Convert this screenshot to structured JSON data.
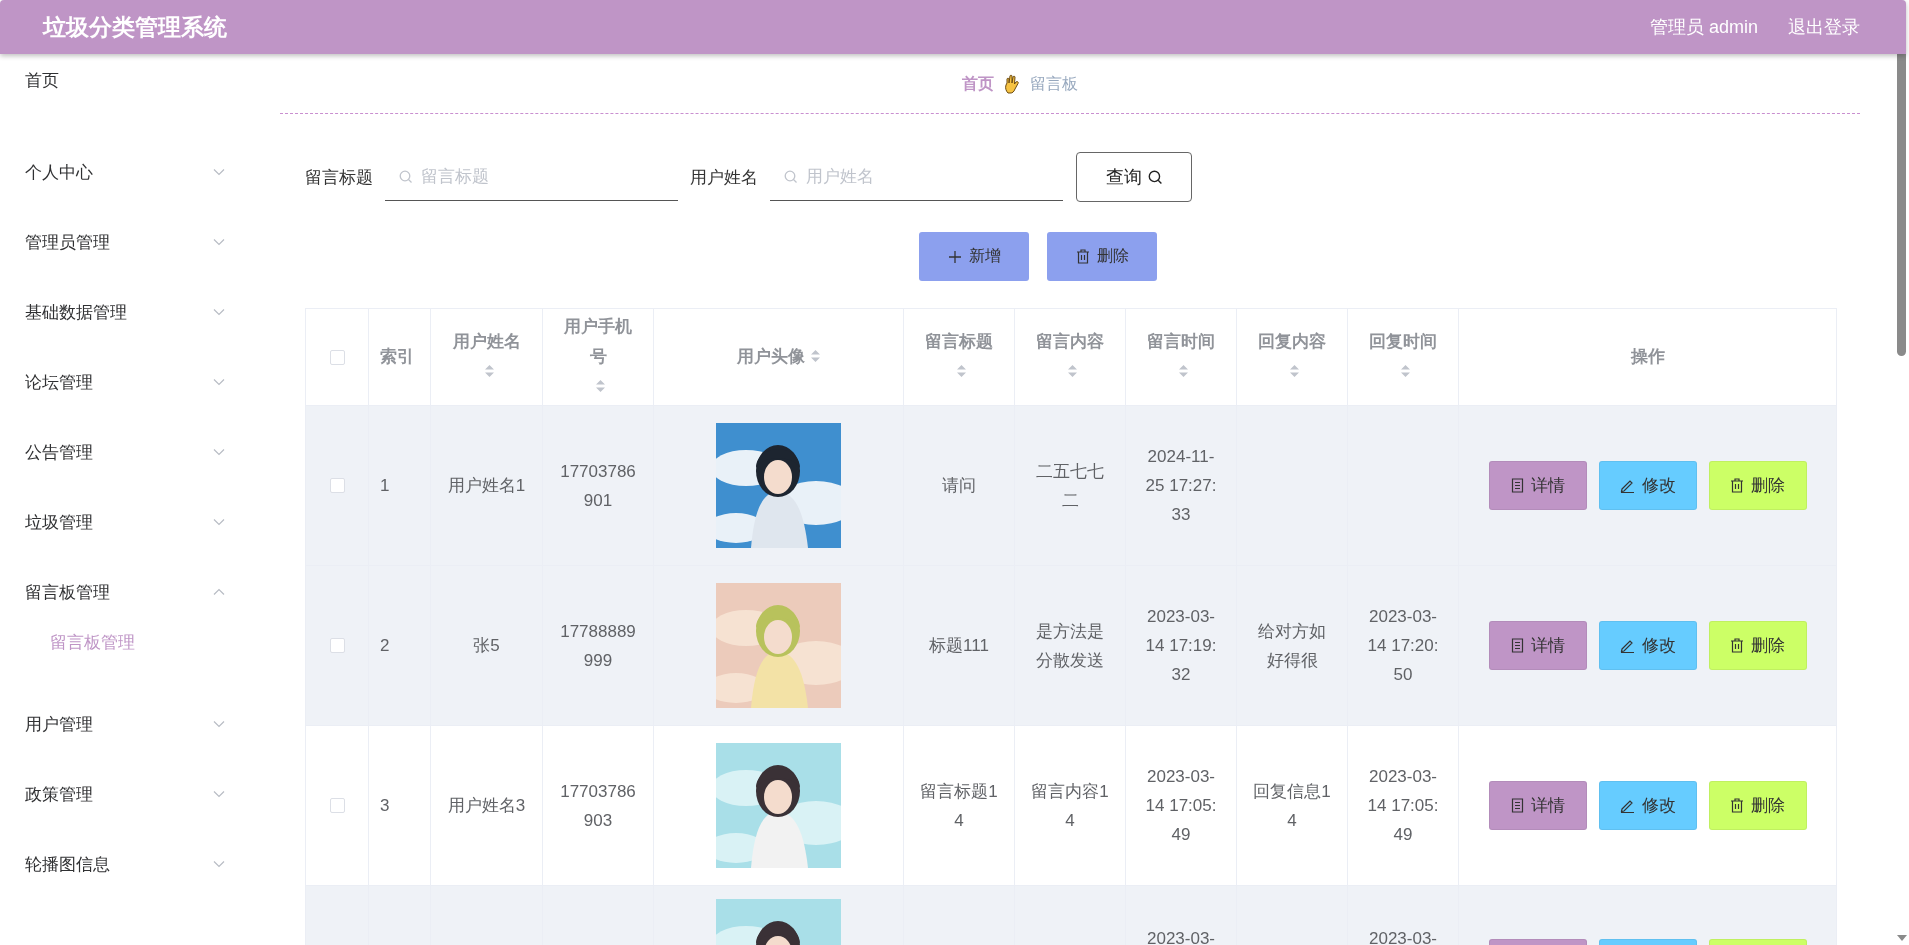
{
  "header": {
    "title": "垃圾分类管理系统",
    "user": "管理员 admin",
    "logout": "退出登录"
  },
  "sidebar": {
    "items": [
      {
        "label": "首页",
        "kind": "link"
      },
      {
        "label": "个人中心",
        "kind": "submenu",
        "expanded": false
      },
      {
        "label": "管理员管理",
        "kind": "submenu",
        "expanded": false
      },
      {
        "label": "基础数据管理",
        "kind": "submenu",
        "expanded": false
      },
      {
        "label": "论坛管理",
        "kind": "submenu",
        "expanded": false
      },
      {
        "label": "公告管理",
        "kind": "submenu",
        "expanded": false
      },
      {
        "label": "垃圾管理",
        "kind": "submenu",
        "expanded": false
      },
      {
        "label": "留言板管理",
        "kind": "submenu",
        "expanded": true,
        "children": [
          {
            "label": "留言板管理",
            "selected": true
          }
        ]
      },
      {
        "label": "用户管理",
        "kind": "submenu",
        "expanded": false
      },
      {
        "label": "政策管理",
        "kind": "submenu",
        "expanded": false
      },
      {
        "label": "轮播图信息",
        "kind": "submenu",
        "expanded": false
      }
    ]
  },
  "breadcrumb": [
    {
      "label": "首页",
      "selected": true
    },
    {
      "label": "留言板",
      "selected": false
    }
  ],
  "search": {
    "fields": [
      {
        "label": "留言标题",
        "placeholder": "留言标题"
      },
      {
        "label": "用户姓名",
        "placeholder": "用户姓名"
      }
    ],
    "button": "查询"
  },
  "toolbar": [
    {
      "kind": "add",
      "label": "新增"
    },
    {
      "kind": "delete",
      "label": "删除"
    }
  ],
  "table": {
    "columns": [
      {
        "kind": "check",
        "checked": false
      },
      {
        "kind": "index",
        "label": "索引",
        "sortable": false
      },
      {
        "kind": "name",
        "label": "用户姓名",
        "sortable": true
      },
      {
        "kind": "phone",
        "label": "用户手机号",
        "sortable": true
      },
      {
        "kind": "avatar",
        "label": "用户头像",
        "sortable": true
      },
      {
        "kind": "title",
        "label": "留言标题",
        "sortable": true
      },
      {
        "kind": "content",
        "label": "留言内容",
        "sortable": true
      },
      {
        "kind": "time",
        "label": "留言时间",
        "sortable": true
      },
      {
        "kind": "reply",
        "label": "回复内容",
        "sortable": true
      },
      {
        "kind": "rtime",
        "label": "回复时间",
        "sortable": true
      },
      {
        "kind": "actions",
        "label": "操作",
        "sortable": false
      }
    ],
    "rows": [
      {
        "kind": "full",
        "checked": false,
        "highlighted": true,
        "index": "1",
        "name": "用户姓名1",
        "phone": "17703786901",
        "avatar": {
          "kind": "picture"
        },
        "title": "请问",
        "content": "二五七七二",
        "time": "2024-11-25 17:27:33",
        "actions": [
          {
            "kind": "detail",
            "label": "详情"
          },
          {
            "kind": "edit",
            "label": "修改"
          },
          {
            "kind": "delete",
            "label": "删除"
          }
        ]
      },
      {
        "kind": "full",
        "checked": false,
        "highlighted": true,
        "index": "2",
        "name": "张5",
        "phone": "17788889999",
        "avatar": {
          "kind": "picture"
        },
        "title": "标题111",
        "content": "是方法是分散发送",
        "time": "2023-03-14 17:19:32",
        "reply": "给对方如好得很",
        "rtime": "2023-03-14 17:20:50",
        "actions": [
          {
            "kind": "detail",
            "label": "详情"
          },
          {
            "kind": "edit",
            "label": "修改"
          },
          {
            "kind": "delete",
            "label": "删除"
          }
        ]
      },
      {
        "kind": "full",
        "checked": false,
        "highlighted": false,
        "index": "3",
        "name": "用户姓名3",
        "phone": "17703786903",
        "avatar": {
          "kind": "picture"
        },
        "title": "留言标题14",
        "content": "留言内容14",
        "time": "2023-03-14 17:05:49",
        "reply": "回复信息14",
        "rtime": "2023-03-14 17:05:49",
        "actions": [
          {
            "kind": "detail",
            "label": "详情"
          },
          {
            "kind": "edit",
            "label": "修改"
          },
          {
            "kind": "delete",
            "label": "删除"
          }
        ]
      },
      {
        "kind": "partial",
        "highlighted": true,
        "avatar": {
          "kind": "picture"
        },
        "time": "2023-03-",
        "rtime": "2023-03-",
        "actions": [
          {
            "kind": "detail"
          },
          {
            "kind": "edit"
          },
          {
            "kind": "delete"
          }
        ]
      }
    ]
  }
}
